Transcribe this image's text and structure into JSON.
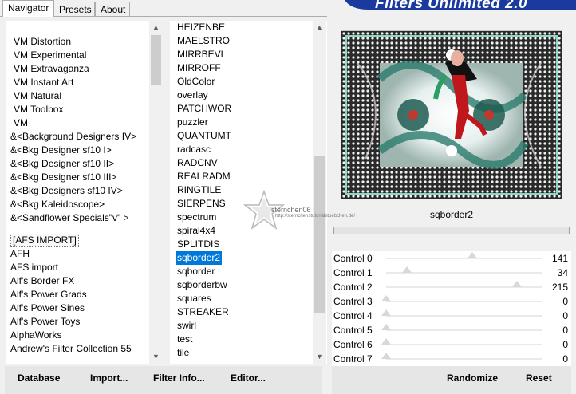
{
  "tabs": [
    {
      "label": "Navigator",
      "active": true
    },
    {
      "label": "Presets",
      "active": false
    },
    {
      "label": "About",
      "active": false
    }
  ],
  "app_title": "Filters Unlimited 2.0",
  "categories": [
    "VM Distortion",
    "VM Experimental",
    "VM Extravaganza",
    "VM Instant Art",
    "VM Natural",
    "VM Toolbox",
    "VM",
    "&<Background Designers IV>",
    "&<Bkg Designer sf10 I>",
    "&<Bkg Designer sf10 II>",
    "&<Bkg Designer sf10 III>",
    "&<Bkg Designers sf10 IV>",
    "&<Bkg Kaleidoscope>",
    "&<Sandflower Specials\"v\" >",
    "[AFS IMPORT]",
    "AFH",
    "AFS import",
    "Alf's Border FX",
    "Alf's Power Grads",
    "Alf's Power Sines",
    "Alf's Power Toys",
    "AlphaWorks",
    "Andrew's Filter Collection 55"
  ],
  "categories_selected_index": 14,
  "filters": [
    "HEIZENBE",
    "MAELSTRO",
    "MIRRBEVL",
    "MIRROFF",
    "OldColor",
    "overlay",
    "PATCHWOR",
    "puzzler",
    "QUANTUMT",
    "radcasc",
    "RADCNV",
    "REALRADM",
    "RINGTILE",
    "SIERPENS",
    "spectrum",
    "spiral4x4",
    "SPLITDIS",
    "sqborder2",
    "sqborder",
    "sqborderbw",
    "squares",
    "STREAKER",
    "swirl",
    "test",
    "tile"
  ],
  "filters_selected_index": 17,
  "selected_filter_name": "sqborder2",
  "controls": [
    {
      "label": "Control 0",
      "value": "141",
      "level": 0.553
    },
    {
      "label": "Control 1",
      "value": "34",
      "level": 0.133
    },
    {
      "label": "Control 2",
      "value": "215",
      "level": 0.843
    },
    {
      "label": "Control 3",
      "value": "0",
      "level": 0
    },
    {
      "label": "Control 4",
      "value": "0",
      "level": 0
    },
    {
      "label": "Control 5",
      "value": "0",
      "level": 0
    },
    {
      "label": "Control 6",
      "value": "0",
      "level": 0
    },
    {
      "label": "Control 7",
      "value": "0",
      "level": 0
    }
  ],
  "buttons": {
    "database": "Database",
    "import": "Import...",
    "filter_info": "Filter Info...",
    "editor": "Editor...",
    "randomize": "Randomize",
    "reset": "Reset"
  },
  "watermark": {
    "line1": "sternchen06",
    "line2": "http://sternchenstutorialstuebchen.de/"
  },
  "colors": {
    "selection": "#0078d7",
    "banner": "#1a3aa0"
  },
  "icons": {
    "scroll_up": "chevron-up-icon",
    "scroll_down": "chevron-down-icon"
  }
}
